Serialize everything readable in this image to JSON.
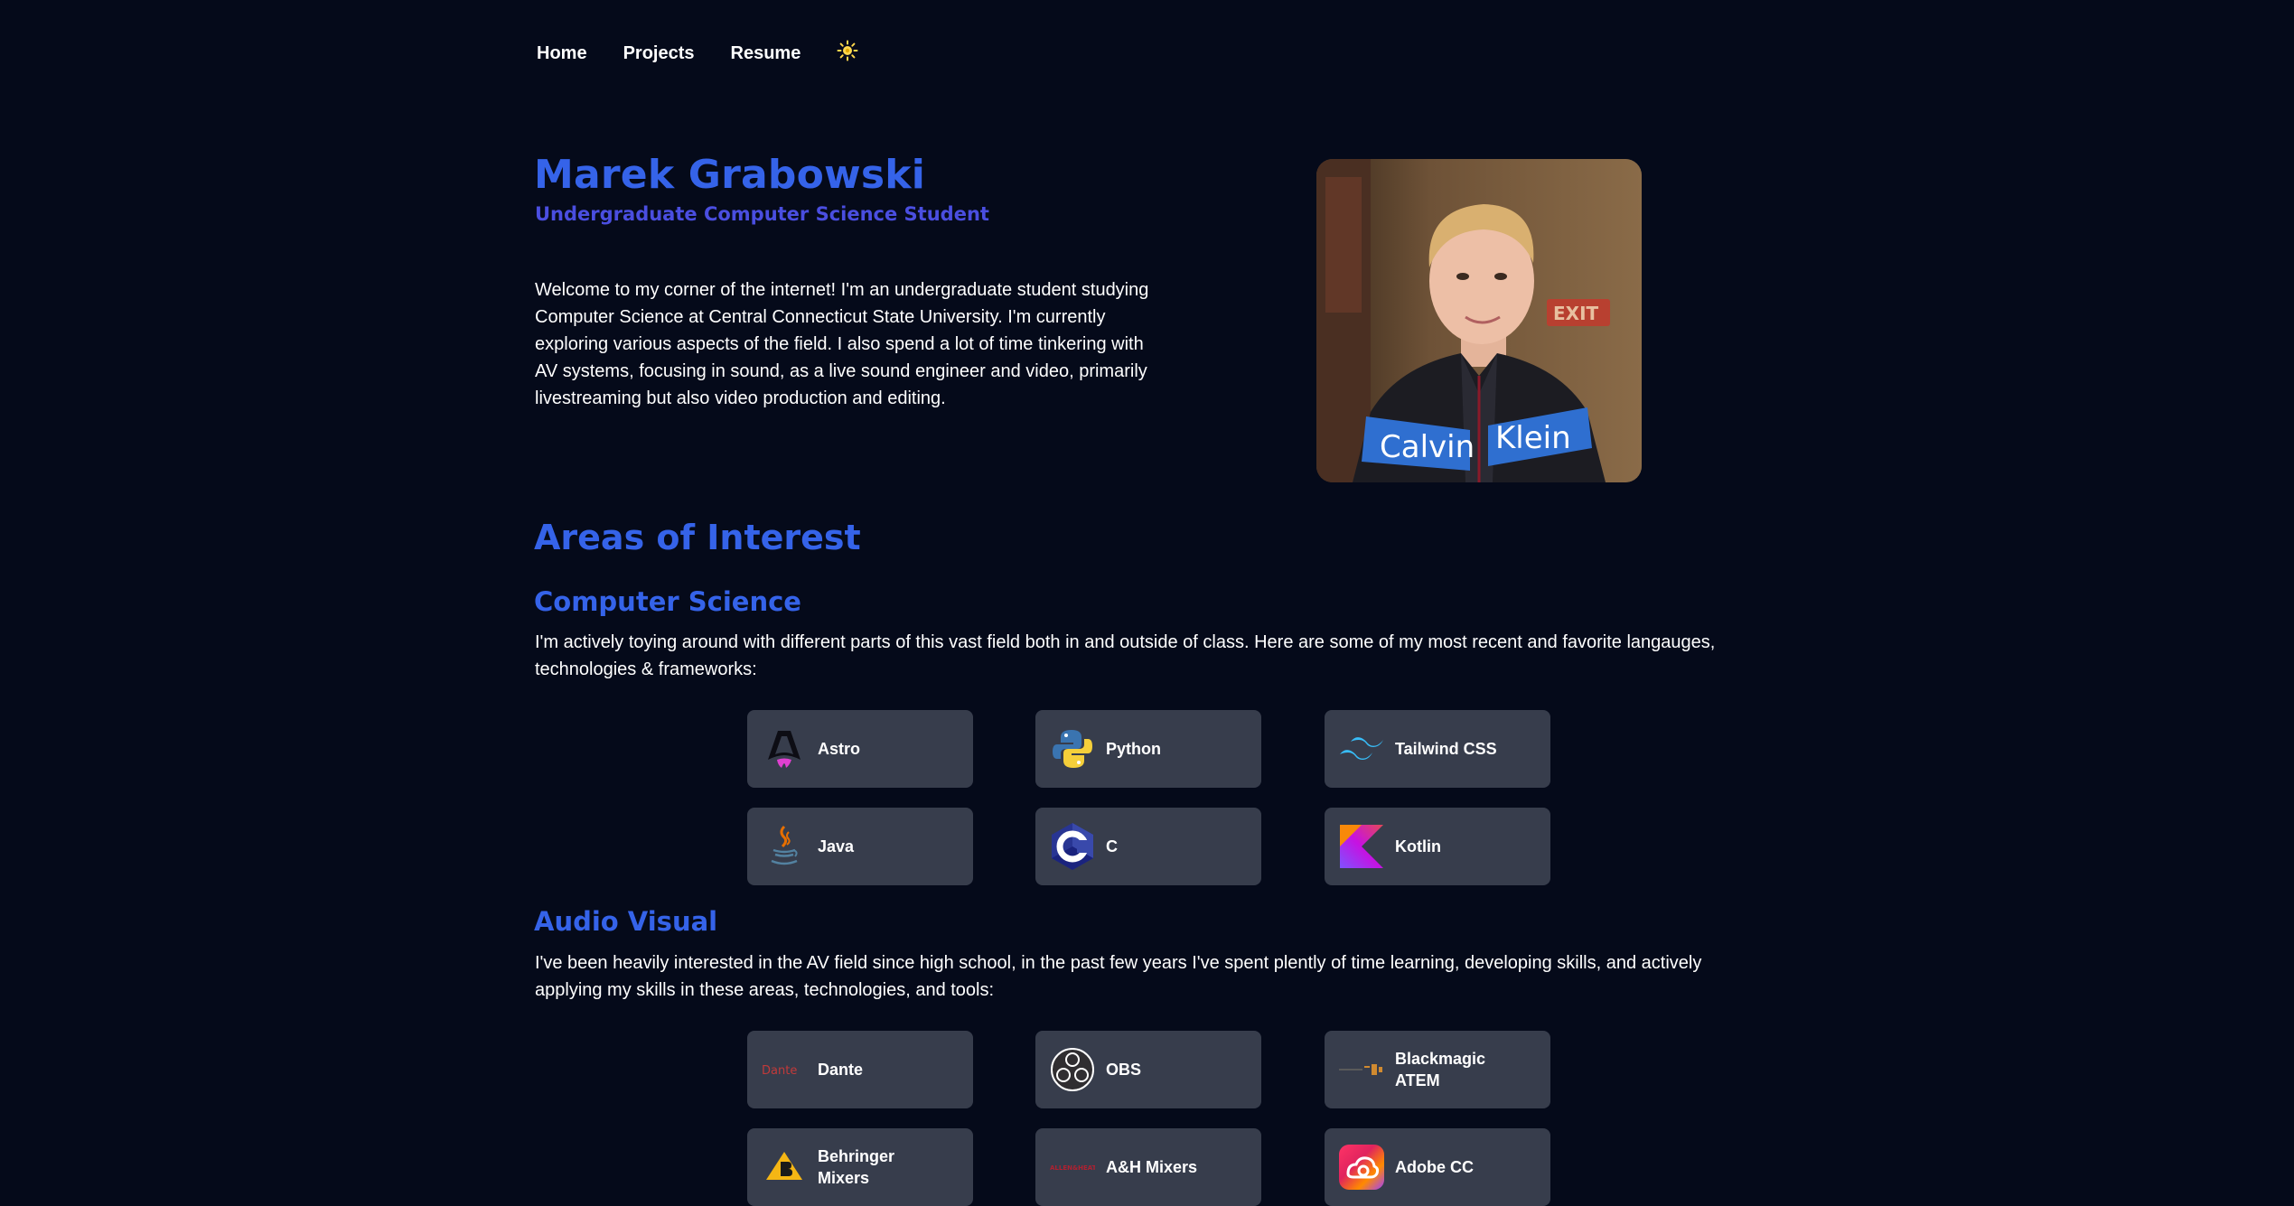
{
  "nav": {
    "home": "Home",
    "projects": "Projects",
    "resume": "Resume",
    "theme_icon": "sun-icon"
  },
  "hero": {
    "name": "Marek Grabowski",
    "subtitle": "Undergraduate Computer Science Student",
    "bio": "Welcome to my corner of the internet! I'm an undergraduate student studying Computer Science at Central Connecticut State University. I'm currently exploring various aspects of the field. I also spend a lot of time tinkering with AV systems, focusing in sound, as a live sound engineer and video, primarily livestreaming but also video production and editing.",
    "photo_jacket_text": "Calvin Klein"
  },
  "areas": {
    "title": "Areas of Interest"
  },
  "cs": {
    "title": "Computer Science",
    "text": "I'm actively toying around with different parts of this vast field both in and outside of class. Here are some of my most recent and favorite langauges, technologies & frameworks:",
    "items": [
      {
        "label": "Astro",
        "icon": "astro-icon"
      },
      {
        "label": "Python",
        "icon": "python-icon"
      },
      {
        "label": "Tailwind CSS",
        "icon": "tailwind-icon"
      },
      {
        "label": "Java",
        "icon": "java-icon"
      },
      {
        "label": "C",
        "icon": "c-icon"
      },
      {
        "label": "Kotlin",
        "icon": "kotlin-icon"
      }
    ]
  },
  "av": {
    "title": "Audio Visual",
    "text": "I've been heavily interested in the AV field since high school, in the past few years I've spent plently of time learning, developing skills, and actively applying my skills in these areas, technologies, and tools:",
    "items": [
      {
        "label": "Dante",
        "icon": "dante-icon",
        "logo_text": "Dante"
      },
      {
        "label": "OBS",
        "icon": "obs-icon"
      },
      {
        "label": "Blackmagic\nATEM",
        "icon": "blackmagic-icon"
      },
      {
        "label": "Behringer\nMixers",
        "icon": "behringer-icon"
      },
      {
        "label": "A&H Mixers",
        "icon": "allen-heath-icon",
        "logo_text": "ALLEN&HEATH"
      },
      {
        "label": "Adobe CC",
        "icon": "adobe-cc-icon"
      }
    ]
  },
  "colors": {
    "background": "#050a1a",
    "accent": "#3563e9",
    "card": "#373d4c",
    "sun": "#ffd84d"
  }
}
